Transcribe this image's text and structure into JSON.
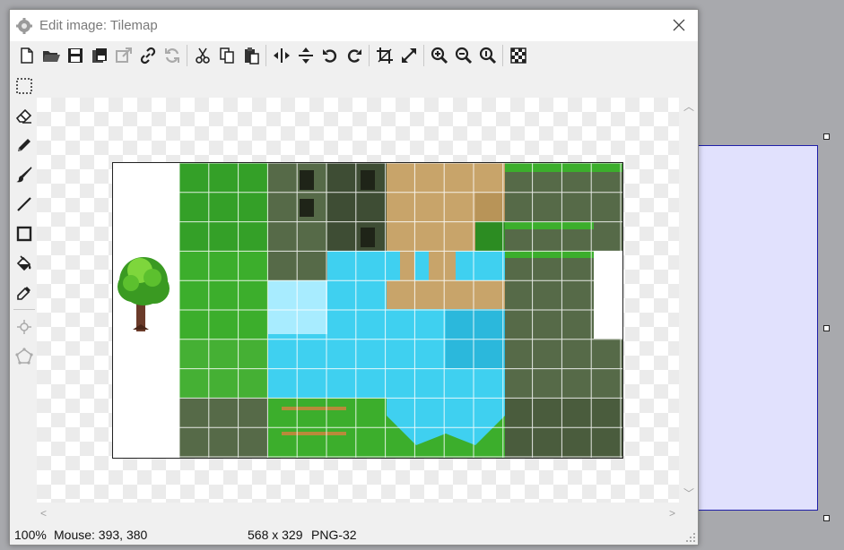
{
  "window": {
    "title": "Edit image: Tilemap"
  },
  "toolbar": {
    "buttons": [
      {
        "name": "new-icon"
      },
      {
        "name": "open-icon"
      },
      {
        "name": "save-icon"
      },
      {
        "name": "save-as-icon"
      },
      {
        "name": "export-icon"
      },
      {
        "name": "link-icon"
      },
      {
        "name": "refresh-icon"
      },
      {
        "name": "cut-icon"
      },
      {
        "name": "copy-icon"
      },
      {
        "name": "paste-icon"
      },
      {
        "name": "flip-horizontal-icon"
      },
      {
        "name": "flip-vertical-icon"
      },
      {
        "name": "rotate-left-icon"
      },
      {
        "name": "rotate-right-icon"
      },
      {
        "name": "crop-icon"
      },
      {
        "name": "resize-icon"
      },
      {
        "name": "zoom-in-icon"
      },
      {
        "name": "zoom-out-icon"
      },
      {
        "name": "zoom-reset-icon"
      },
      {
        "name": "transparency-icon"
      }
    ]
  },
  "sidetools": [
    "select-icon",
    "eraser-icon",
    "pencil-icon",
    "brush-icon",
    "line-icon",
    "rectangle-icon",
    "fill-icon",
    "color-picker-icon",
    "origin-icon",
    "polygon-icon"
  ],
  "status": {
    "zoom": "100%",
    "mouse": "Mouse: 393, 380",
    "size": "568 x 329",
    "format": "PNG-32"
  },
  "colors": {
    "grass": "#3cae2c",
    "grass_dark": "#2c8c22",
    "stone": "#566a48",
    "stone_dark": "#3e4d34",
    "wood": "#c8a46a",
    "water": "#3fd0f0",
    "water_light": "#a8ecff",
    "background_panel": "#e1e1fd"
  }
}
